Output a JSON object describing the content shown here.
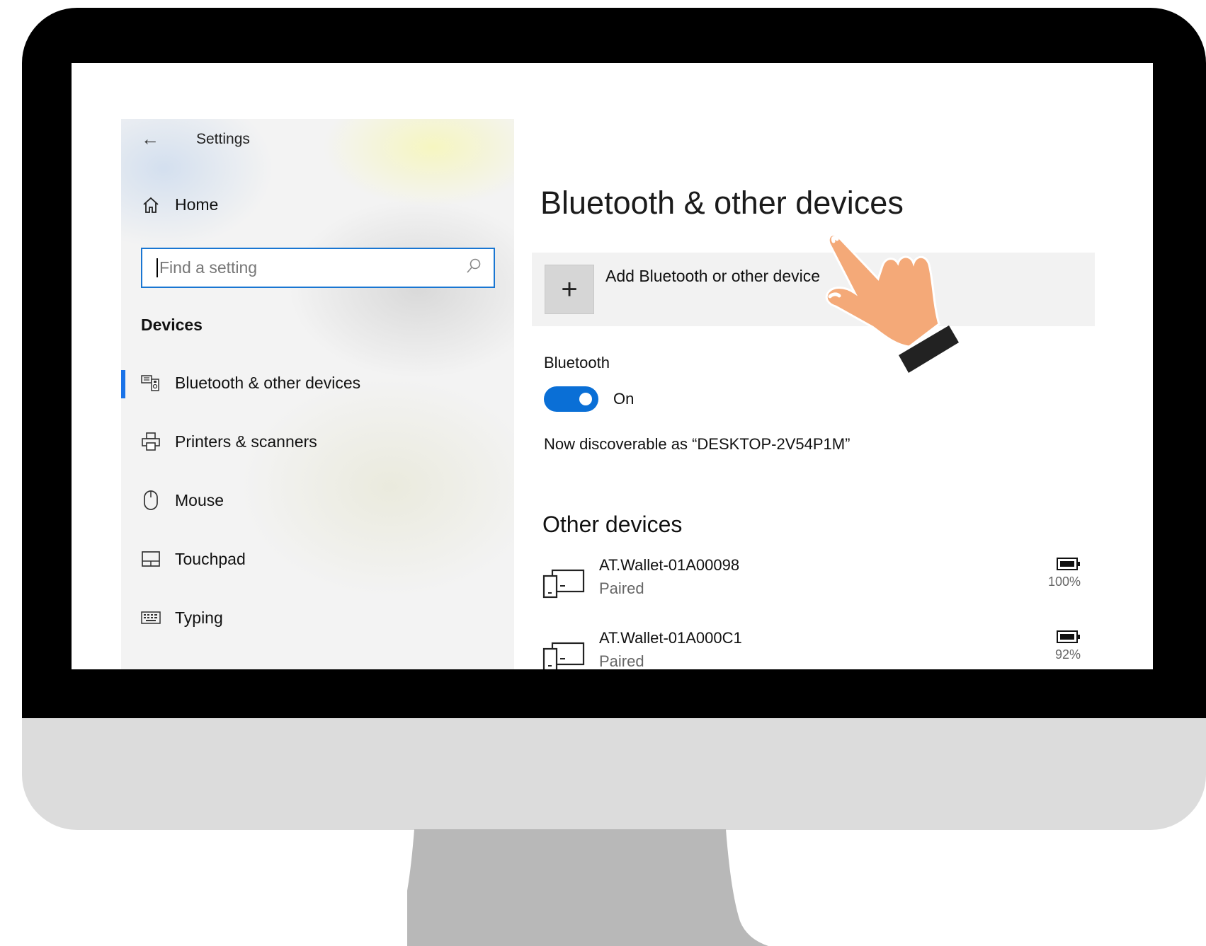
{
  "sidebar": {
    "back_title": "Settings",
    "home_label": "Home",
    "search_placeholder": "Find a setting",
    "section_title": "Devices",
    "items": [
      {
        "label": "Bluetooth & other devices",
        "icon": "bluetooth-devices-icon",
        "active": true
      },
      {
        "label": "Printers & scanners",
        "icon": "printer-icon"
      },
      {
        "label": "Mouse",
        "icon": "mouse-icon"
      },
      {
        "label": "Touchpad",
        "icon": "touchpad-icon"
      },
      {
        "label": "Typing",
        "icon": "keyboard-icon"
      }
    ]
  },
  "main": {
    "title": "Bluetooth & other devices",
    "add_device_label": "Add Bluetooth or other device",
    "bluetooth_label": "Bluetooth",
    "bluetooth_toggle_state": "On",
    "discoverable_text": "Now discoverable as “DESKTOP-2V54P1M”",
    "other_devices_title": "Other devices",
    "devices": [
      {
        "name": "AT.Wallet-01A00098",
        "status": "Paired",
        "battery": "100%"
      },
      {
        "name": "AT.Wallet-01A000C1",
        "status": "Paired",
        "battery": "92%"
      }
    ]
  },
  "colors": {
    "accent": "#1a73e8",
    "toggle_on": "#0a6fd6",
    "hand_skin": "#f4a978",
    "sleeve": "#222222",
    "monitor_bezel": "#000000",
    "monitor_chin": "#dcdcdc",
    "monitor_stand": "#b8b8b8"
  }
}
